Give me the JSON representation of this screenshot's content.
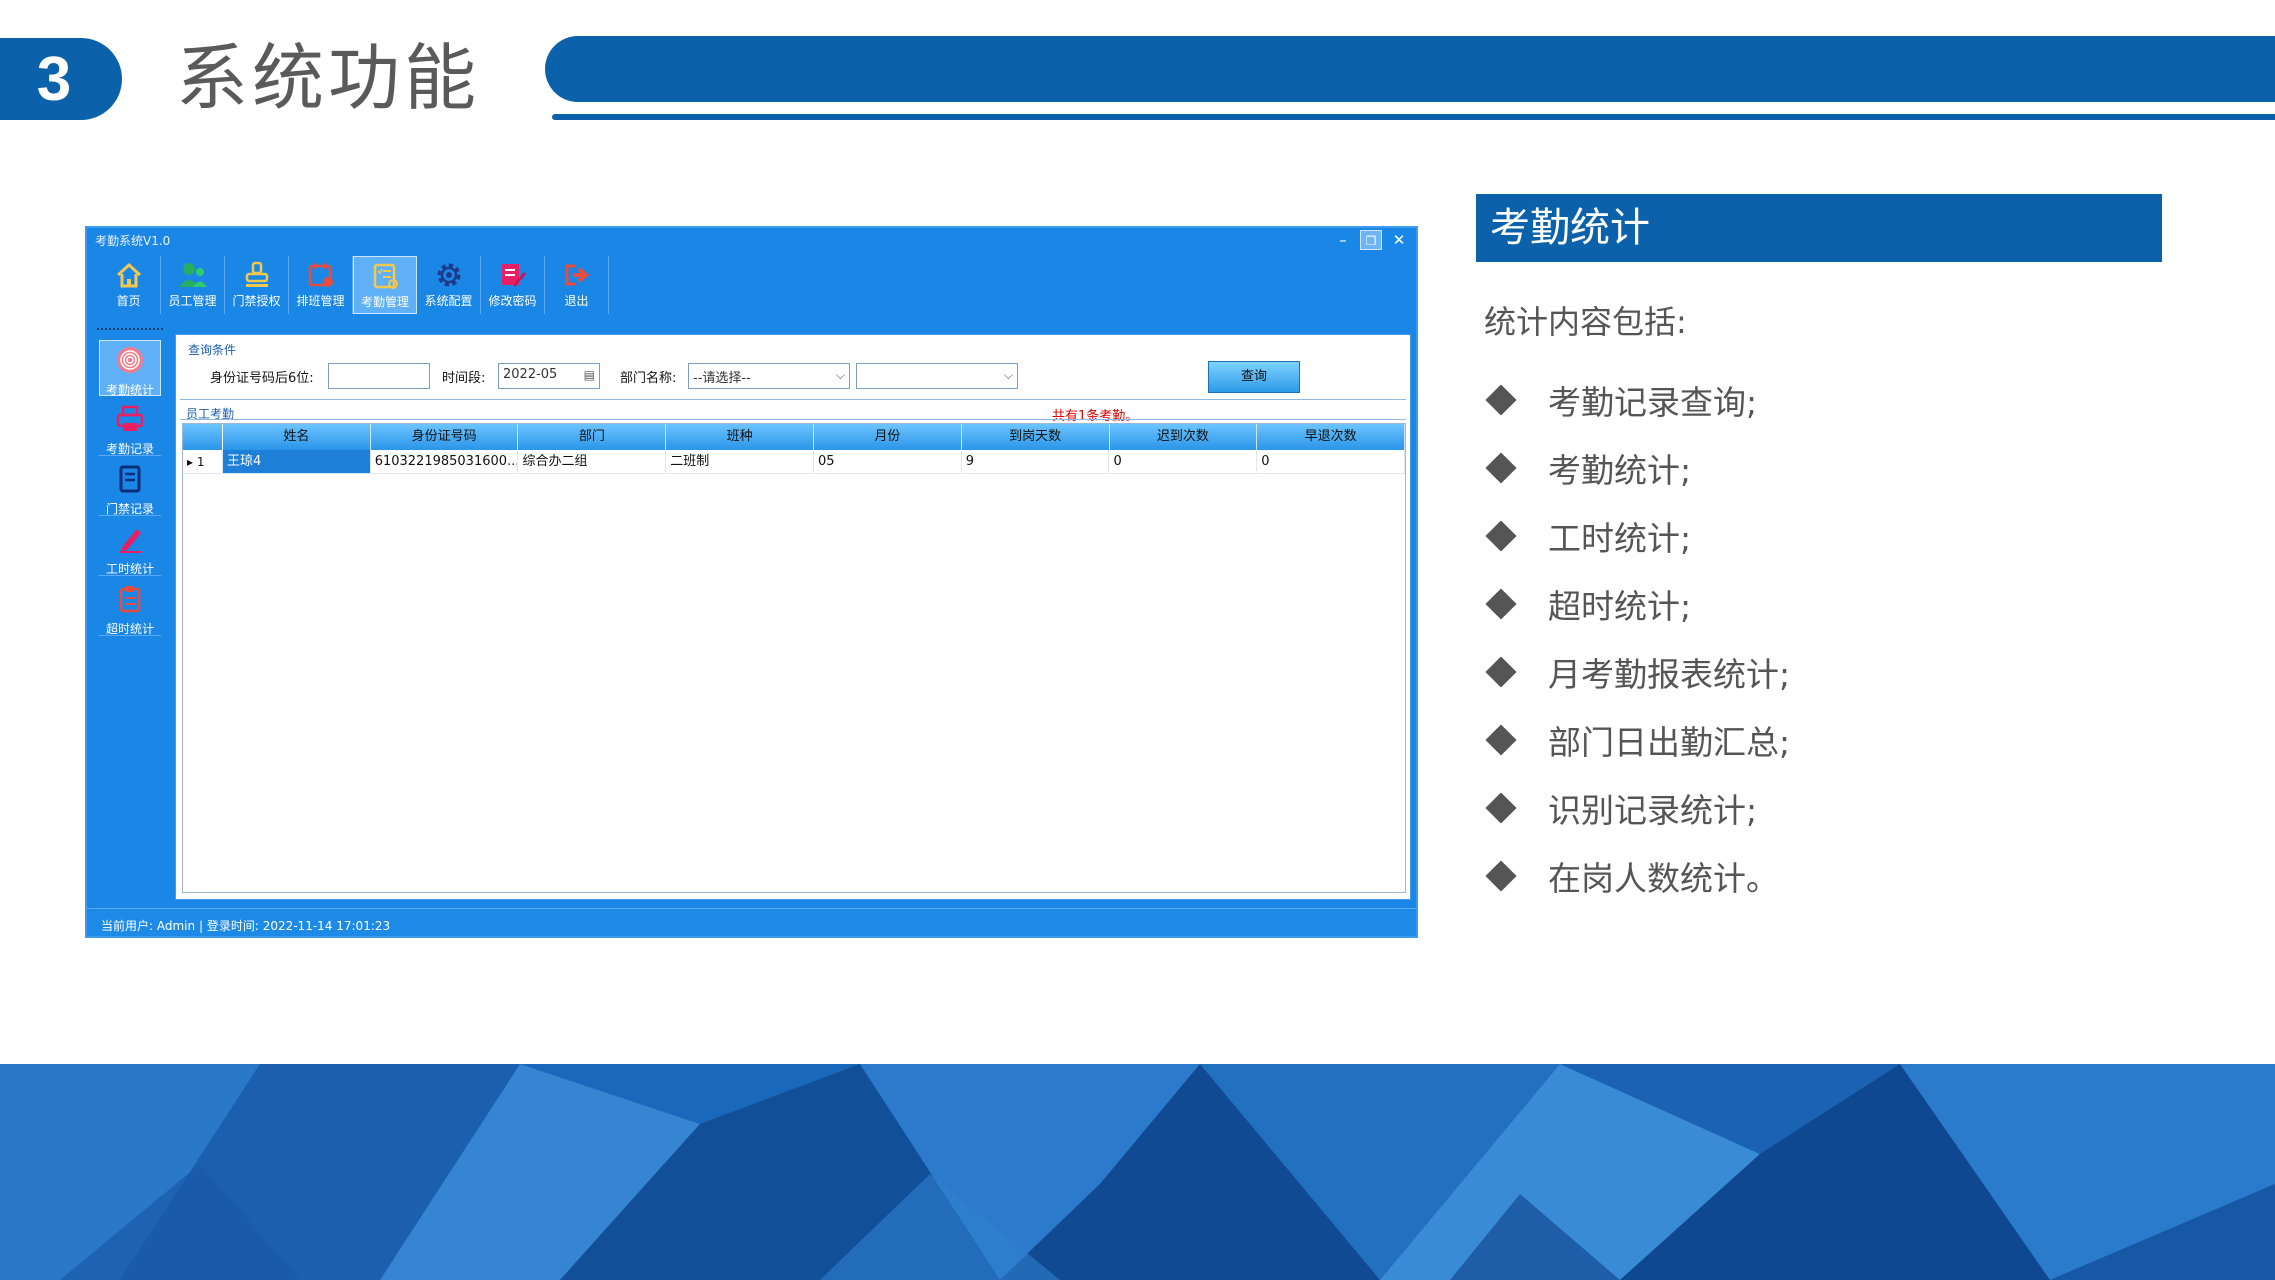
{
  "slide": {
    "section_number": "3",
    "section_title": "系统功能"
  },
  "app": {
    "window_title": "考勤系统V1.0",
    "window_controls": [
      "–",
      "❐",
      "✕"
    ],
    "toolbar": [
      {
        "label": "首页",
        "icon": "home-icon",
        "color": "#f2c94c"
      },
      {
        "label": "员工管理",
        "icon": "users-icon",
        "color": "#27ae60"
      },
      {
        "label": "门禁授权",
        "icon": "stamp-icon",
        "color": "#f2c94c"
      },
      {
        "label": "排班管理",
        "icon": "calendar-icon",
        "color": "#e74c3c"
      },
      {
        "label": "考勤管理",
        "icon": "checklist-icon",
        "color": "#f2c94c"
      },
      {
        "label": "系统配置",
        "icon": "gear-icon",
        "color": "#1e3a8a"
      },
      {
        "label": "修改密码",
        "icon": "edit-password-icon",
        "color": "#e91e63"
      },
      {
        "label": "退出",
        "icon": "exit-icon",
        "color": "#e74c3c"
      }
    ],
    "sidebar": [
      {
        "label": "考勤统计",
        "icon": "fingerprint-icon"
      },
      {
        "label": "考勤记录",
        "icon": "printer-icon"
      },
      {
        "label": "门禁记录",
        "icon": "book-icon"
      },
      {
        "label": "工时统计",
        "icon": "pen-icon"
      },
      {
        "label": "超时统计",
        "icon": "clipboard-icon"
      }
    ],
    "query": {
      "group_label": "查询条件",
      "id_label": "身份证号码后6位:",
      "id_value": "",
      "period_label": "时间段:",
      "period_value": "2022-05",
      "dept_label": "部门名称:",
      "dept_value": "--请选择--",
      "dept_sub_value": "",
      "search_button": "查询"
    },
    "grid": {
      "group_label": "员工考勤",
      "count_text": "共有1条考勤。",
      "columns": [
        "姓名",
        "身份证号码",
        "部门",
        "班种",
        "月份",
        "到岗天数",
        "迟到次数",
        "早退次数"
      ],
      "rows": [
        {
          "index": "1",
          "cells": [
            "王琼4",
            "6103221985031600...",
            "综合办二组",
            "二班制",
            "05",
            "9",
            "0",
            "0"
          ]
        }
      ]
    },
    "status": {
      "user_label": "当前用户:",
      "user_value": "Admin",
      "login_label": "登录时间:",
      "login_value": "2022-11-14 17:01:23"
    }
  },
  "panel": {
    "title": "考勤统计",
    "intro": "统计内容包括:",
    "items": [
      "考勤记录查询;",
      "考勤统计;",
      "工时统计;",
      "超时统计;",
      "月考勤报表统计;",
      "部门日出勤汇总;",
      "识别记录统计;",
      "在岗人数统计。"
    ]
  }
}
